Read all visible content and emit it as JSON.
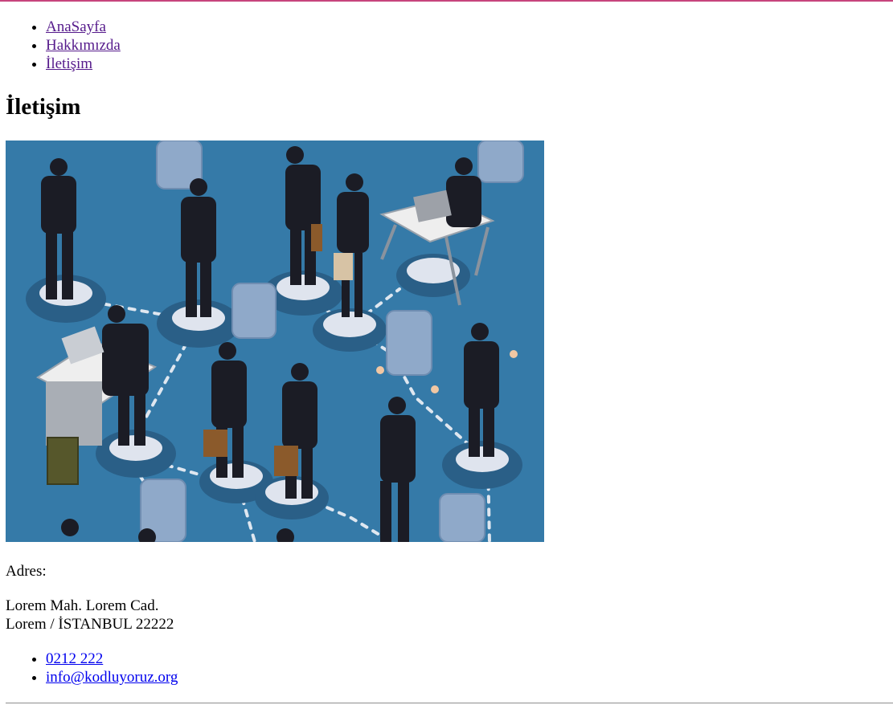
{
  "colors": {
    "accent_border": "#c7457d",
    "visited_link": "#551a8b",
    "link": "#0000ee",
    "hero_bg": "#357aa8"
  },
  "nav": {
    "items": [
      {
        "label": "AnaSayfa"
      },
      {
        "label": "Hakkımızda"
      },
      {
        "label": "İletişim"
      }
    ]
  },
  "page": {
    "title": "İletişim"
  },
  "hero": {
    "alt": "İletişim"
  },
  "address": {
    "label": "Adres:",
    "line1": "Lorem Mah. Lorem Cad.",
    "line2": "Lorem / İSTANBUL 22222"
  },
  "contact": {
    "phone": "0212 222",
    "email": "info@kodluyoruz.org"
  }
}
